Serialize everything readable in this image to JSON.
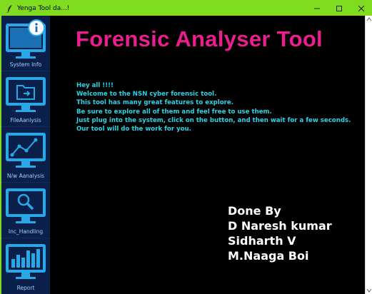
{
  "window": {
    "title": "Yenga Tool da...!",
    "accent_color": "#7fdc1e"
  },
  "sidebar": {
    "items": [
      {
        "label": "System Info",
        "icon": "system-info-monitor-icon"
      },
      {
        "label": "FileAanlysis",
        "icon": "file-analysis-monitor-icon"
      },
      {
        "label": "N/w Aanalysis",
        "icon": "network-analysis-monitor-icon"
      },
      {
        "label": "Inc_Handling",
        "icon": "incident-handling-monitor-icon"
      },
      {
        "label": "Report",
        "icon": "report-monitor-icon"
      }
    ]
  },
  "main": {
    "title": "Forensic Analyser Tool",
    "title_color": "#ee1d8f",
    "intro_color": "#2ad3e6",
    "intro_lines": [
      "Hey all !!!!",
      "Welcome to the NSN cyber forensic tool.",
      "This tool has many great features to explore.",
      "Be sure to explore all of them and feel free to use them.",
      "Just plug into the system, click on the button, and then wait for a few seconds.",
      "Our tool will do the work for you."
    ],
    "credits": [
      "Done By",
      "D Naresh kumar",
      "Sidharth V",
      "M.Naaga Boi"
    ]
  }
}
